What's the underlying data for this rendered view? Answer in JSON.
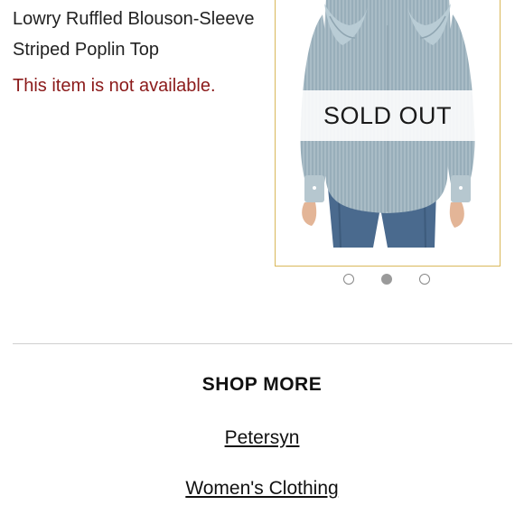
{
  "product": {
    "title_line1": "Lowry Ruffled Blouson-Sleeve",
    "title_line2": "Striped Poplin Top",
    "availability": "This item is not available.",
    "sold_out_label": "SOLD OUT"
  },
  "carousel": {
    "slide_count": 3,
    "active_index": 1
  },
  "shop_more": {
    "heading": "SHOP MORE",
    "links": [
      "Petersyn",
      "Women's Clothing"
    ]
  },
  "colors": {
    "availability_text": "#8b1a1a",
    "frame_border": "#d9b85a",
    "active_dot": "#9a9a9a"
  }
}
